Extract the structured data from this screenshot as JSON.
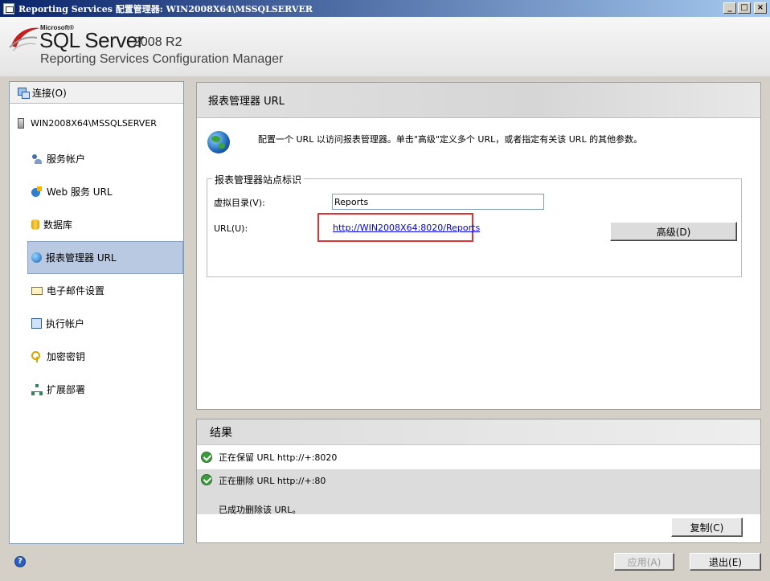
{
  "window": {
    "title": "Reporting Services 配置管理器: WIN2008X64\\MSSQLSERVER",
    "minimize": "_",
    "maximize": "□",
    "close": "×"
  },
  "brand": {
    "microsoft": "Microsoft®",
    "product": "SQL Server",
    "version": "2008 R2",
    "subtitle": "Reporting Services Configuration Manager"
  },
  "sidebar": {
    "connect_label": "连接(O)",
    "server": "WIN2008X64\\MSSQLSERVER",
    "items": [
      {
        "label": "服务帐户",
        "icon": "service-account-icon"
      },
      {
        "label": "Web 服务 URL",
        "icon": "web-service-icon"
      },
      {
        "label": "数据库",
        "icon": "database-icon"
      },
      {
        "label": "报表管理器 URL",
        "icon": "globe-icon",
        "selected": true
      },
      {
        "label": "电子邮件设置",
        "icon": "mail-icon"
      },
      {
        "label": "执行帐户",
        "icon": "execution-account-icon"
      },
      {
        "label": "加密密钥",
        "icon": "key-icon"
      },
      {
        "label": "扩展部署",
        "icon": "scale-out-icon"
      }
    ]
  },
  "main": {
    "title": "报表管理器 URL",
    "intro": "配置一个 URL 以访问报表管理器。单击\"高级\"定义多个 URL，或者指定有关该 URL 的其他参数。",
    "group_title": "报表管理器站点标识",
    "virtual_dir_label": "虚拟目录(V):",
    "virtual_dir_value": "Reports",
    "url_label": "URL(U):",
    "url_value": "http://WIN2008X64:8020/Reports",
    "advanced_button": "高级(D)"
  },
  "results": {
    "title": "结果",
    "rows": [
      {
        "text": "正在保留 URL http://+:8020",
        "status": "success"
      },
      {
        "text": "正在删除 URL http://+:80",
        "status": "success"
      }
    ],
    "message": "已成功删除该 URL。",
    "copy_button": "复制(C)"
  },
  "footer": {
    "help": "?",
    "apply_button": "应用(A)",
    "exit_button": "退出(E)"
  },
  "colors": {
    "highlight_border": "#e03434",
    "link": "#0000ee",
    "selected_nav": "#b8c9e1"
  }
}
